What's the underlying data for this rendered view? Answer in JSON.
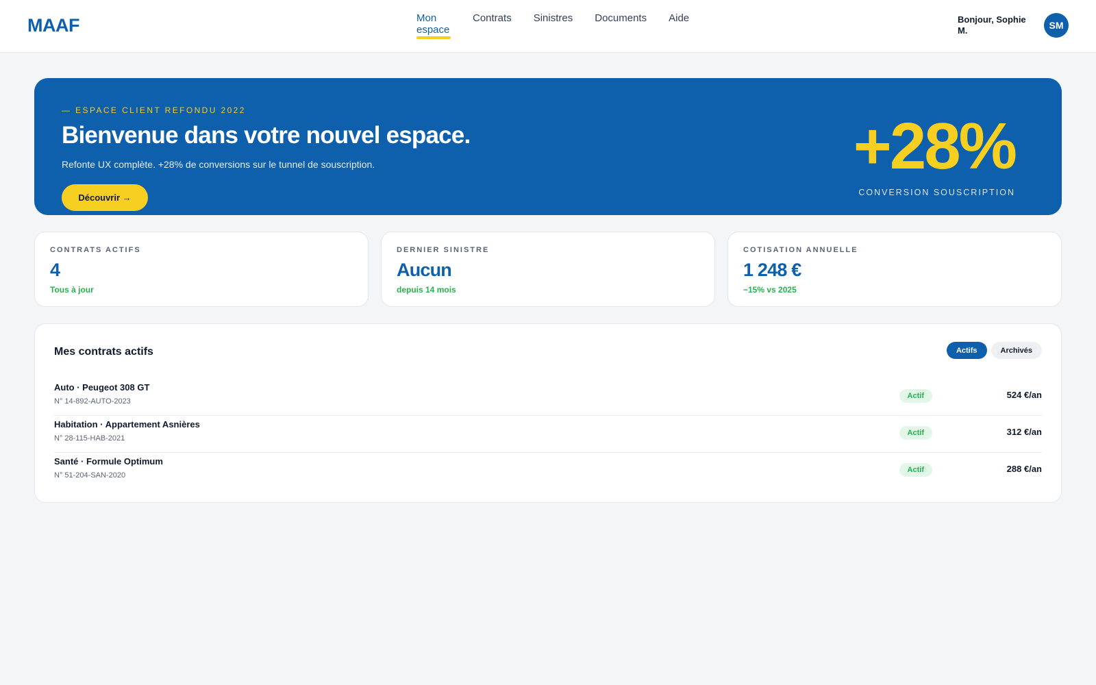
{
  "header": {
    "logo": "MAAF",
    "nav": [
      {
        "label": "Mon espace",
        "active": true
      },
      {
        "label": "Contrats"
      },
      {
        "label": "Sinistres"
      },
      {
        "label": "Documents"
      },
      {
        "label": "Aide"
      }
    ],
    "greeting": "Bonjour, Sophie M.",
    "avatar_initials": "SM"
  },
  "hero": {
    "eyebrow": "— ESPACE CLIENT REFONDU 2022",
    "title": "Bienvenue dans votre nouvel espace.",
    "subtitle": "Refonte UX complète. +28% de conversions sur le tunnel de souscription.",
    "button_label": "Découvrir →",
    "stat_value": "+28%",
    "stat_label": "CONVERSION SOUSCRIPTION"
  },
  "kpis": [
    {
      "label": "CONTRATS ACTIFS",
      "value": "4",
      "sub": "Tous à jour"
    },
    {
      "label": "DERNIER SINISTRE",
      "value": "Aucun",
      "sub": "depuis 14 mois"
    },
    {
      "label": "COTISATION ANNUELLE",
      "value": "1 248 €",
      "sub": "−15% vs 2025"
    }
  ],
  "contracts": {
    "title": "Mes contrats actifs",
    "filters": [
      {
        "label": "Actifs",
        "selected": true
      },
      {
        "label": "Archivés",
        "selected": false
      }
    ],
    "rows": [
      {
        "name": "Auto · Peugeot 308 GT",
        "number": "N° 14-892-AUTO-2023",
        "status": "Actif",
        "price": "524 €/an"
      },
      {
        "name": "Habitation · Appartement Asnières",
        "number": "N° 28-115-HAB-2021",
        "status": "Actif",
        "price": "312 €/an"
      },
      {
        "name": "Santé · Formule Optimum",
        "number": "N° 51-204-SAN-2020",
        "status": "Actif",
        "price": "288 €/an"
      }
    ]
  },
  "colors": {
    "brand_blue": "#0e5fac",
    "accent_yellow": "#f7cf20",
    "success_green": "#25b24a"
  }
}
